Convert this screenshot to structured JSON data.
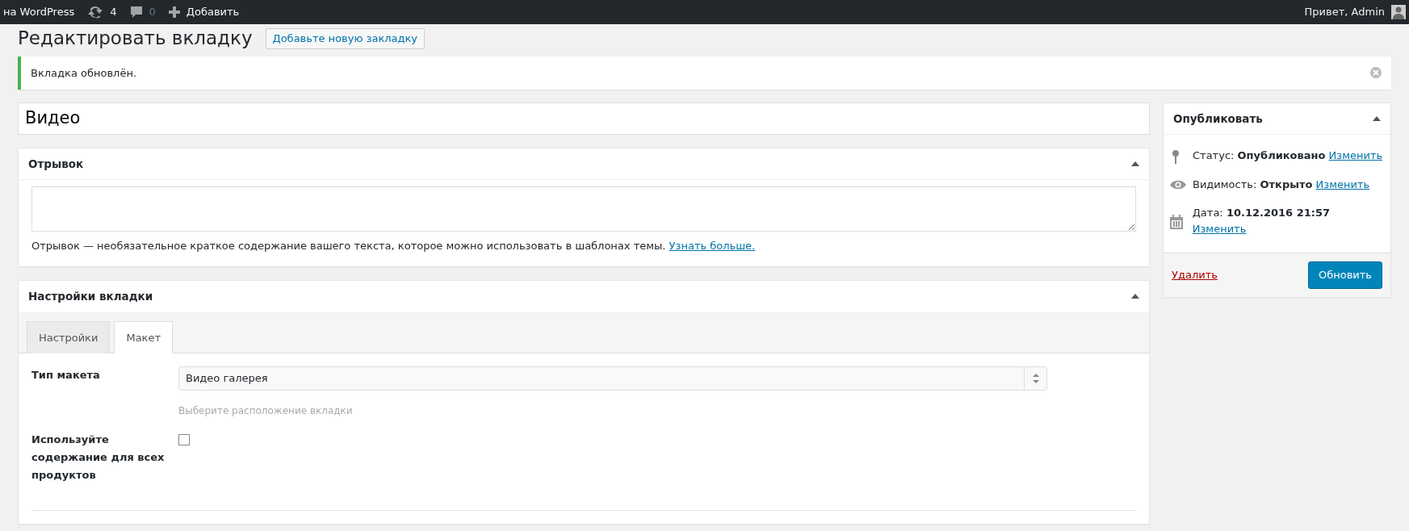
{
  "admin_bar": {
    "site": "на WordPress",
    "updates": "4",
    "comments": "0",
    "add": "Добавить",
    "greeting": "Привет, Admin"
  },
  "header": {
    "title": "Редактировать вкладку",
    "add_button": "Добавьте новую закладку"
  },
  "notice": {
    "text": "Вкладка обновлён."
  },
  "post_title": {
    "value": "Видео"
  },
  "excerpt": {
    "title": "Отрывок",
    "expanded": true,
    "hint": "Отрывок — необязательное краткое содержание вашего текста, которое можно использовать в шаблонах темы.",
    "link": "Узнать больше."
  },
  "settings": {
    "title": "Настройки вкладки",
    "expanded": true,
    "tabs": [
      {
        "label": "Настройки",
        "selected": false
      },
      {
        "label": "Макет",
        "selected": true
      }
    ],
    "fields": [
      {
        "kind": "select",
        "label": "Тип макета",
        "value": "Видео галерея",
        "help": "Выберите расположение вкладки"
      },
      {
        "kind": "checkbox",
        "label": "Используйте содержание для всех продуктов",
        "checked": false
      }
    ]
  },
  "publish": {
    "title": "Опубликовать",
    "expanded": true,
    "rows": [
      {
        "kind": "status",
        "text": "Статус: **Опубликовано**",
        "link": "Изменить"
      },
      {
        "kind": "visibility",
        "text": "Видимость: **Открыто**",
        "link": "Изменить"
      },
      {
        "kind": "date",
        "text": "Дата: **10.12.2016 21:57**",
        "link": "Изменить"
      }
    ],
    "delete": "Удалить",
    "update": "Обновить"
  }
}
